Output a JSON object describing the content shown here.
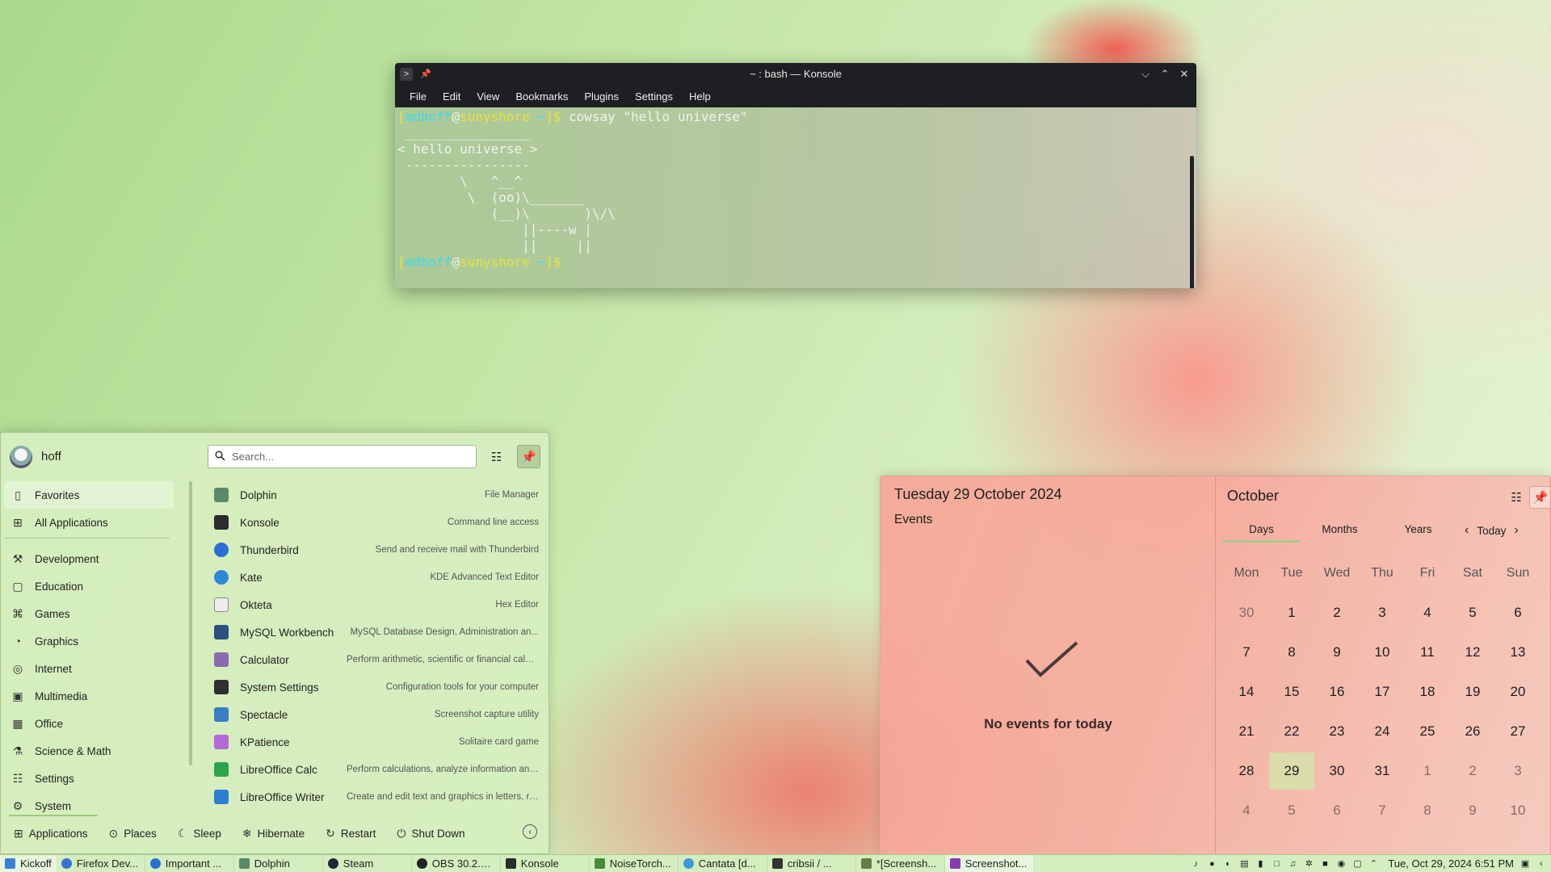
{
  "konsole": {
    "title": "~ : bash — Konsole",
    "menu": [
      "File",
      "Edit",
      "View",
      "Bookmarks",
      "Plugins",
      "Settings",
      "Help"
    ],
    "prompt": {
      "open": "[",
      "user": "mdhoff",
      "at": "@",
      "host": "sunyshore",
      "dir": "~",
      "close": "]$"
    },
    "command": " cowsay \"hello universe\"",
    "output": " ________________\n< hello universe >\n ----------------\n        \\   ^__^\n         \\  (oo)\\_______\n            (__)\\       )\\/\\\n                ||----w |\n                ||     ||"
  },
  "kickoff": {
    "username": "hoff",
    "search_placeholder": "Search...",
    "categories": [
      {
        "label": "Favorites",
        "icon": "bookmark-icon"
      },
      {
        "label": "All Applications",
        "icon": "grid-icon"
      },
      {
        "label": "Development",
        "icon": "hammer-icon"
      },
      {
        "label": "Education",
        "icon": "education-icon"
      },
      {
        "label": "Games",
        "icon": "gamepad-icon"
      },
      {
        "label": "Graphics",
        "icon": "palette-icon"
      },
      {
        "label": "Internet",
        "icon": "globe-icon"
      },
      {
        "label": "Multimedia",
        "icon": "multimedia-icon"
      },
      {
        "label": "Office",
        "icon": "office-icon"
      },
      {
        "label": "Science & Math",
        "icon": "flask-icon"
      },
      {
        "label": "Settings",
        "icon": "sliders-icon"
      },
      {
        "label": "System",
        "icon": "gear-icon"
      }
    ],
    "apps": [
      {
        "name": "Dolphin",
        "desc": "File Manager",
        "color": "#5a8a6a"
      },
      {
        "name": "Konsole",
        "desc": "Command line access",
        "color": "#2a2c30"
      },
      {
        "name": "Thunderbird",
        "desc": "Send and receive mail with Thunderbird",
        "color": "#2a6fd6"
      },
      {
        "name": "Kate",
        "desc": "KDE Advanced Text Editor",
        "color": "#2f86d8"
      },
      {
        "name": "Okteta",
        "desc": "Hex Editor",
        "color": "#e8e8e8"
      },
      {
        "name": "MySQL Workbench",
        "desc": "MySQL Database Design, Administration an...",
        "color": "#2b4f7e"
      },
      {
        "name": "Calculator",
        "desc": "Perform arithmetic, scientific or financial calculations",
        "color": "#8a6ab0"
      },
      {
        "name": "System Settings",
        "desc": "Configuration tools for your computer",
        "color": "#2d2f33"
      },
      {
        "name": "Spectacle",
        "desc": "Screenshot capture utility",
        "color": "#3a7fc4"
      },
      {
        "name": "KPatience",
        "desc": "Solitaire card game",
        "color": "#b36ad6"
      },
      {
        "name": "LibreOffice Calc",
        "desc": "Perform calculations, analyze information and ...",
        "color": "#2ea44f"
      },
      {
        "name": "LibreOffice Writer",
        "desc": "Create and edit text and graphics in letters, re...",
        "color": "#2d7fd6"
      }
    ],
    "footer": {
      "applications": "Applications",
      "places": "Places",
      "sleep": "Sleep",
      "hibernate": "Hibernate",
      "restart": "Restart",
      "shutdown": "Shut Down"
    }
  },
  "calendar": {
    "date_title": "Tuesday 29 October 2024",
    "events_label": "Events",
    "no_events": "No events for today",
    "month": "October",
    "tabs": [
      "Days",
      "Months",
      "Years"
    ],
    "today": "Today",
    "weekdays": [
      "Mon",
      "Tue",
      "Wed",
      "Thu",
      "Fri",
      "Sat",
      "Sun"
    ],
    "weeks": [
      [
        "30",
        "1",
        "2",
        "3",
        "4",
        "5",
        "6"
      ],
      [
        "7",
        "8",
        "9",
        "10",
        "11",
        "12",
        "13"
      ],
      [
        "14",
        "15",
        "16",
        "17",
        "18",
        "19",
        "20"
      ],
      [
        "21",
        "22",
        "23",
        "24",
        "25",
        "26",
        "27"
      ],
      [
        "28",
        "29",
        "30",
        "31",
        "1",
        "2",
        "3"
      ],
      [
        "4",
        "5",
        "6",
        "7",
        "8",
        "9",
        "10"
      ]
    ],
    "today_day": "29"
  },
  "taskbar": {
    "launcher": "Kickoff",
    "tasks": [
      {
        "label": "Firefox Dev...",
        "color": "#3b6fd8"
      },
      {
        "label": "Important ...",
        "color": "#2a6fd6"
      },
      {
        "label": "Dolphin",
        "color": "#5a8a6a"
      },
      {
        "label": "Steam",
        "color": "#1b2838"
      },
      {
        "label": "OBS 30.2.1...",
        "color": "#222"
      },
      {
        "label": "Konsole",
        "color": "#2a2c30"
      },
      {
        "label": "NoiseTorch...",
        "color": "#4a8a3a"
      },
      {
        "label": "Cantata [d...",
        "color": "#3a9ad6"
      },
      {
        "label": "cribsii / ...",
        "color": "#333"
      },
      {
        "label": "*[Screensh...",
        "color": "#6a7a4a"
      },
      {
        "label": "Screenshot...",
        "color": "#8a3ab0"
      }
    ],
    "clock": "Tue, Oct 29, 2024 6:51 PM"
  }
}
